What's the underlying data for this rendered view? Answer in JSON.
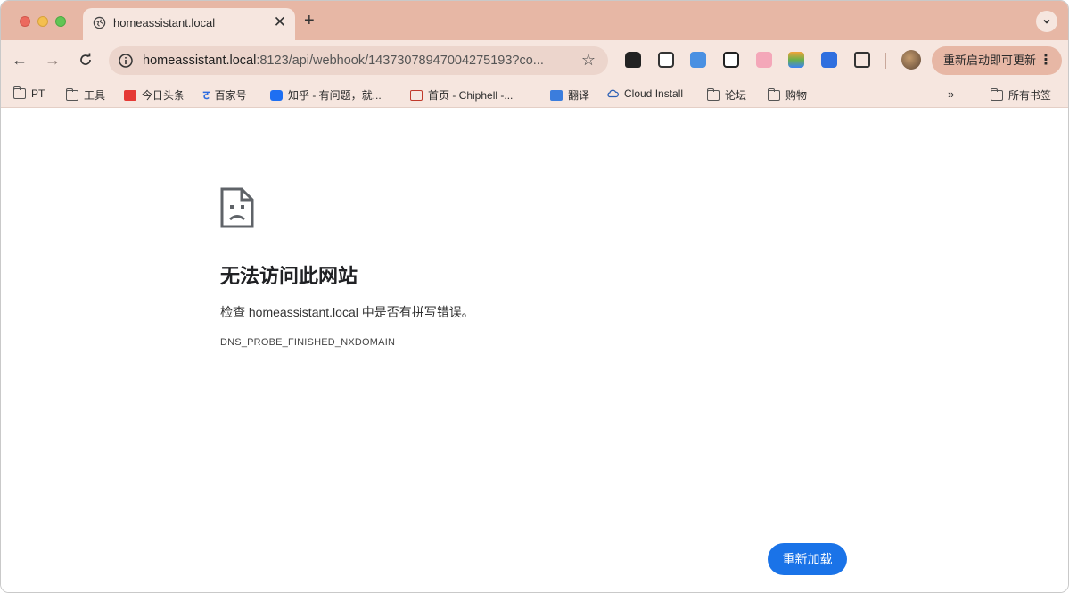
{
  "tab": {
    "title": "homeassistant.local",
    "close_glyph": "✕",
    "new_tab_glyph": "+",
    "search_tabs_glyph": "⌄"
  },
  "toolbar": {
    "back_glyph": "←",
    "forward_glyph": "→",
    "reload_glyph": "C",
    "url_host": "homeassistant.local",
    "url_rest": ":8123/api/webhook/14373078947004275193?co...",
    "bookmark_star_glyph": "☆",
    "update_label": "重新启动即可更新",
    "menu_glyph": "⋮",
    "extension_icons": [
      "ghost-extension-icon",
      "bitwarden-extension-icon",
      "screenshot-extension-icon",
      "crop-extension-icon",
      "bilibili-extension-icon",
      "layers-extension-icon",
      "translate-d-extension-icon",
      "puzzle-extensions-icon"
    ]
  },
  "bookmarks": {
    "items": [
      {
        "label": "PT",
        "icon": "folder-icon"
      },
      {
        "label": "工具",
        "icon": "folder-icon"
      },
      {
        "label": "今日头条",
        "icon": "toutiao-icon"
      },
      {
        "label": "百家号",
        "icon": "baijiahao-icon"
      },
      {
        "label": "知乎 - 有问题，就...",
        "icon": "zhihu-icon"
      },
      {
        "label": "首页 - Chiphell -...",
        "icon": "chiphell-icon"
      },
      {
        "label": "翻译",
        "icon": "translate-icon"
      },
      {
        "label": "Cloud Install",
        "icon": "cloud-icon"
      },
      {
        "label": "论坛",
        "icon": "folder-icon"
      },
      {
        "label": "购物",
        "icon": "folder-icon"
      }
    ],
    "overflow_glyph": "»",
    "all_bookmarks_label": "所有书签"
  },
  "error": {
    "title": "无法访问此网站",
    "detail": "检查 homeassistant.local 中是否有拼写错误。",
    "code": "DNS_PROBE_FINISHED_NXDOMAIN",
    "reload_label": "重新加载"
  },
  "colors": {
    "tabstrip": "#e7b7a5",
    "toolbar": "#f6e6df",
    "accent": "#1a73e8"
  }
}
